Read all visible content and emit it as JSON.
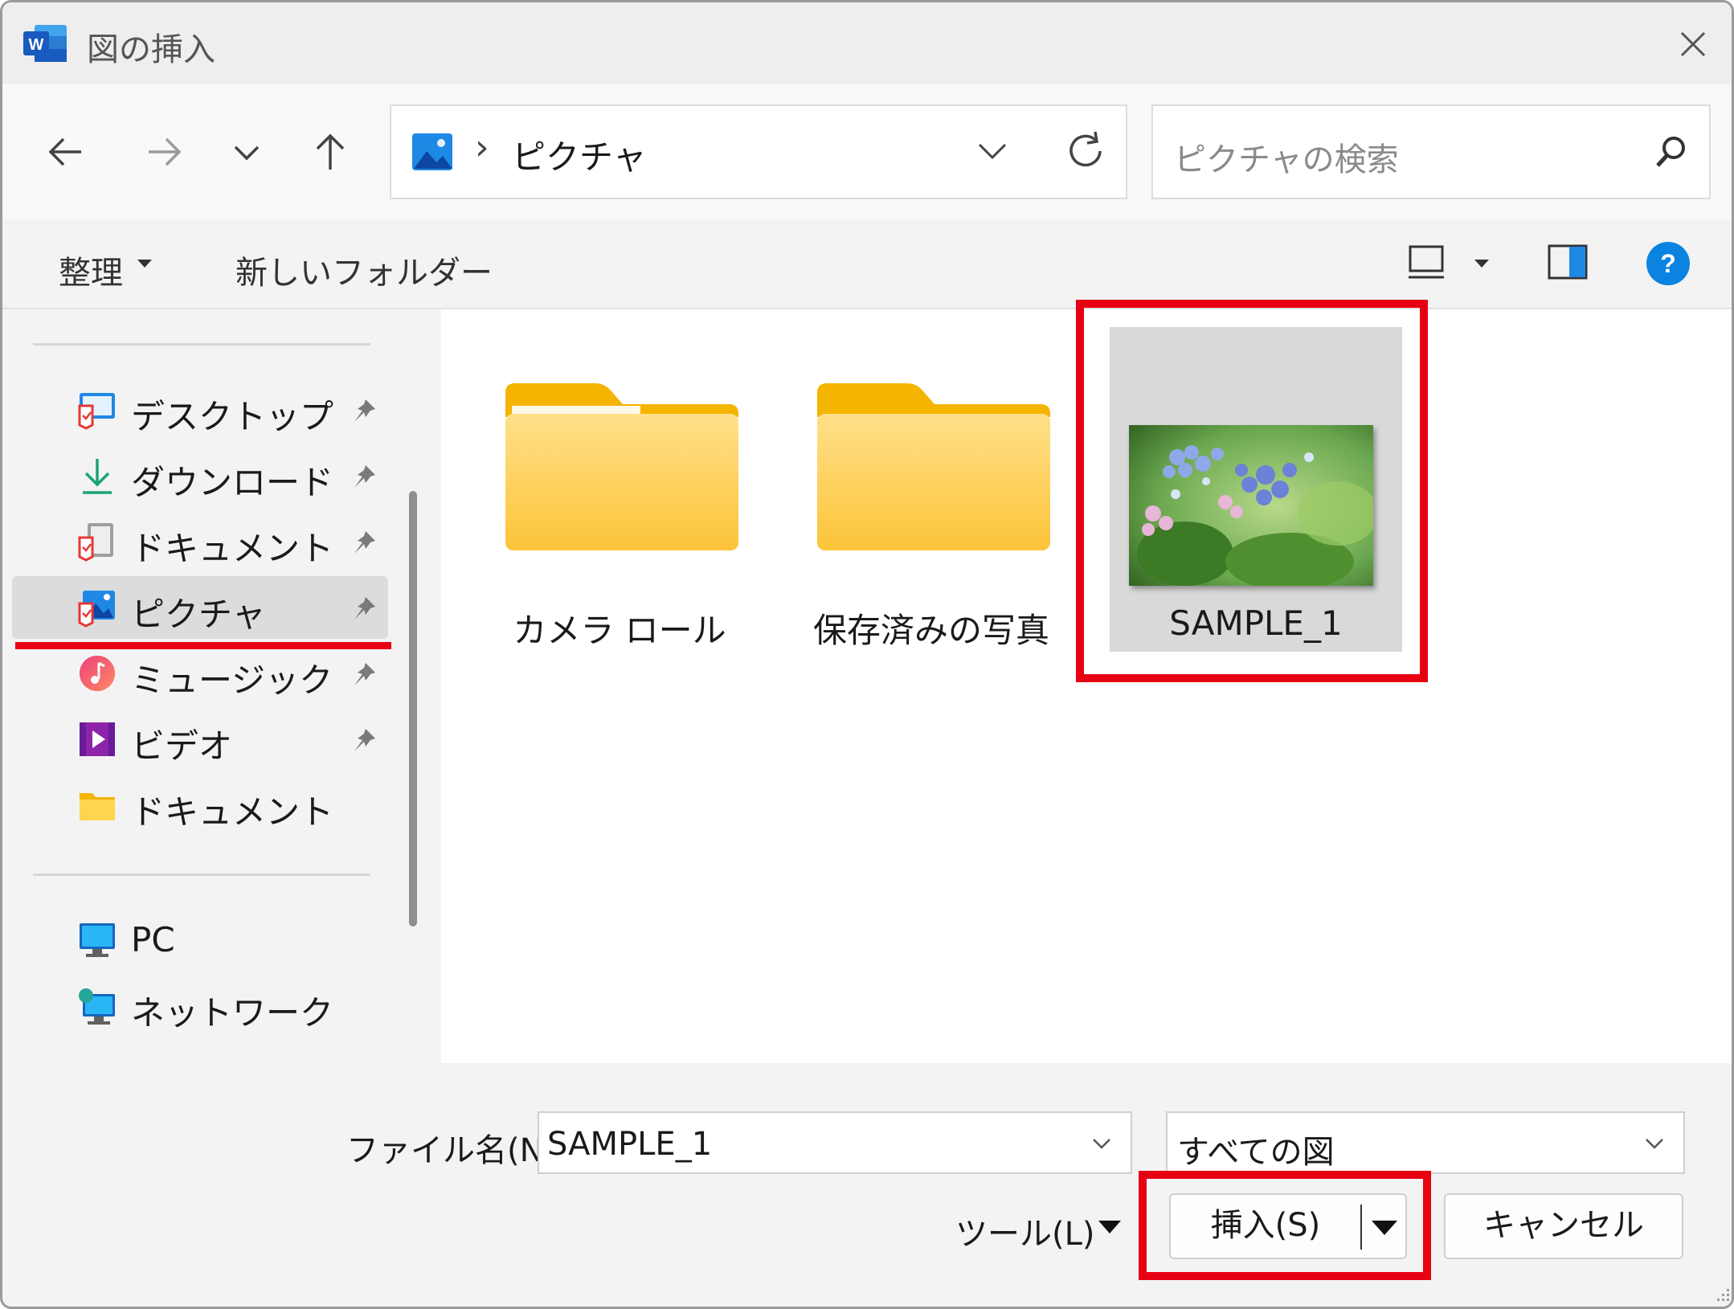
{
  "window": {
    "title": "図の挿入",
    "app_icon": "word-icon",
    "close_icon": "close-icon"
  },
  "nav": {
    "back_icon": "arrow-left-icon",
    "forward_icon": "arrow-right-icon",
    "recent_icon": "chevron-down-icon",
    "up_icon": "arrow-up-icon",
    "address": {
      "location_icon": "pictures-icon",
      "separator": "›",
      "path": "ピクチャ"
    },
    "search": {
      "placeholder": "ピクチャの検索"
    }
  },
  "toolbar": {
    "organize": "整理",
    "new_folder": "新しいフォルダー"
  },
  "sidebar": {
    "items": [
      {
        "label": "デスクトップ",
        "icon": "desktop-icon",
        "pinned": true
      },
      {
        "label": "ダウンロード",
        "icon": "download-icon",
        "pinned": true
      },
      {
        "label": "ドキュメント",
        "icon": "documents-icon",
        "pinned": true
      },
      {
        "label": "ピクチャ",
        "icon": "pictures-icon",
        "pinned": true,
        "selected": true
      },
      {
        "label": "ミュージック",
        "icon": "music-icon",
        "pinned": true
      },
      {
        "label": "ビデオ",
        "icon": "video-icon",
        "pinned": true
      },
      {
        "label": "ドキュメント",
        "icon": "folder-icon",
        "pinned": false
      }
    ],
    "locations": [
      {
        "label": "PC",
        "icon": "pc-icon"
      },
      {
        "label": "ネットワーク",
        "icon": "network-icon"
      }
    ]
  },
  "files": [
    {
      "name": "カメラ ロール",
      "type": "folder"
    },
    {
      "name": "保存済みの写真",
      "type": "folder"
    },
    {
      "name": "SAMPLE_1",
      "type": "image",
      "selected": true
    }
  ],
  "footer": {
    "filename_label": "ファイル名(N):",
    "filename_value": "SAMPLE_1",
    "filetype_value": "すべての図",
    "tools_label": "ツール(L)",
    "insert_label": "挿入(S)",
    "cancel_label": "キャンセル"
  },
  "colors": {
    "highlight": "#e60012",
    "accent": "#0078d4",
    "folder": "#f8c94b"
  }
}
